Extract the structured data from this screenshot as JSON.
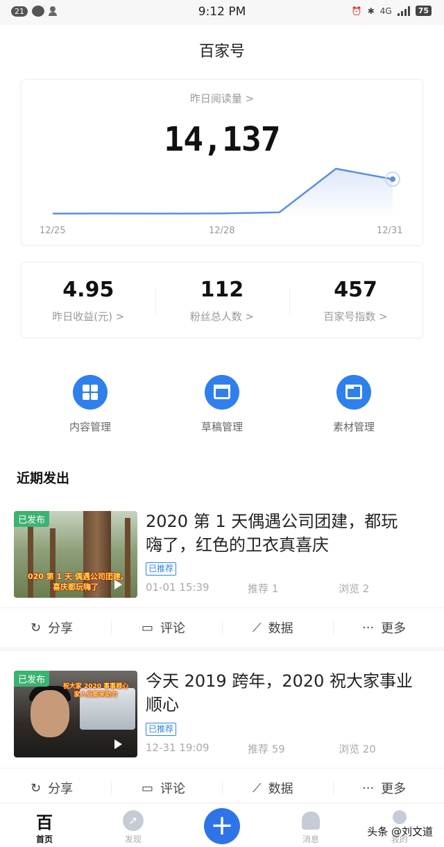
{
  "status_bar": {
    "notification_count": "21",
    "time": "9:12 PM",
    "network": "4G",
    "battery": "75"
  },
  "header": {
    "title": "百家号"
  },
  "reads": {
    "label": "昨日阅读量 >",
    "value": "14,137",
    "chart_data": {
      "type": "area",
      "x": [
        "12/25",
        "12/26",
        "12/27",
        "12/28",
        "12/29",
        "12/30",
        "12/31"
      ],
      "values": [
        120,
        150,
        110,
        180,
        600,
        18400,
        14137
      ],
      "tick_labels": [
        "12/25",
        "12/28",
        "12/31"
      ],
      "color": "#5b8ee0"
    }
  },
  "stats": [
    {
      "value": "4.95",
      "label": "昨日收益(元) >"
    },
    {
      "value": "112",
      "label": "粉丝总人数 >"
    },
    {
      "value": "457",
      "label": "百家号指数 >"
    }
  ],
  "tools": [
    {
      "label": "内容管理",
      "icon": "grid-icon"
    },
    {
      "label": "草稿管理",
      "icon": "draft-icon"
    },
    {
      "label": "素材管理",
      "icon": "folder-icon"
    }
  ],
  "section_title": "近期发出",
  "posts": [
    {
      "badge": "已发布",
      "thumb_caption": [
        "020 第 1 天 偶遇公司团建,",
        "喜庆都玩嗨了"
      ],
      "title_line1": "2020 第 1 天偶遇公司团建，都玩",
      "title_line2": "嗨了，红色的卫衣真喜庆",
      "tag": "已推荐",
      "date": "01-01 15:39",
      "recommend": "推荐 1",
      "views": "浏览 2"
    },
    {
      "badge": "已发布",
      "thumb_caption": [
        "祝大家 2020 事事顺心",
        "家人们都来助力"
      ],
      "title_line1": "今天 2019 跨年，2020 祝大家事业",
      "title_line2": "顺心",
      "tag": "已推荐",
      "date": "12-31 19:09",
      "recommend": "推荐 59",
      "views": "浏览 20"
    }
  ],
  "actions": {
    "share": "分享",
    "comment": "评论",
    "data": "数据",
    "more": "更多"
  },
  "tabbar": {
    "home": "首页",
    "discover": "发现",
    "add": "+",
    "messages": "消息",
    "mine": "我的",
    "home_logo": "百"
  },
  "watermark": "头条 @刘文道",
  "colors": {
    "accent": "#2f80ed",
    "published": "#3cb371"
  }
}
